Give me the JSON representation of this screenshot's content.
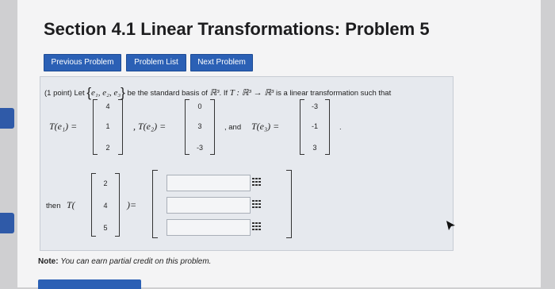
{
  "title": "Section 4.1 Linear Transformations: Problem 5",
  "nav": {
    "previous": "Previous Problem",
    "list": "Problem List",
    "next": "Next Problem"
  },
  "problem": {
    "points": "(1 point) Let",
    "basis": "e₁, e₂, e₃",
    "be_standard_basis_of": "be the standard basis of",
    "R3": "ℝ³",
    "if_T": ". If",
    "T_map": "T : ℝ³ → ℝ³",
    "is_linear": "is a linear transformation such that"
  },
  "equations": {
    "T_e1_label": "T(e₁) =",
    "T_e1": [
      "4",
      "1",
      "2"
    ],
    "T_e2_label": ", T(e₂) =",
    "T_e2": [
      "0",
      "3",
      "-3"
    ],
    "and_label": ", and",
    "T_e3_label": "T(e₃) =",
    "T_e3": [
      "-3",
      "-1",
      "3"
    ],
    "period": "."
  },
  "query": {
    "then": "then",
    "T_open": "T(",
    "vector": [
      "2",
      "4",
      "5"
    ],
    "close_eq": ")="
  },
  "answers": [
    "",
    "",
    ""
  ],
  "note": {
    "label": "Note:",
    "text": "You can earn partial credit on this problem."
  }
}
